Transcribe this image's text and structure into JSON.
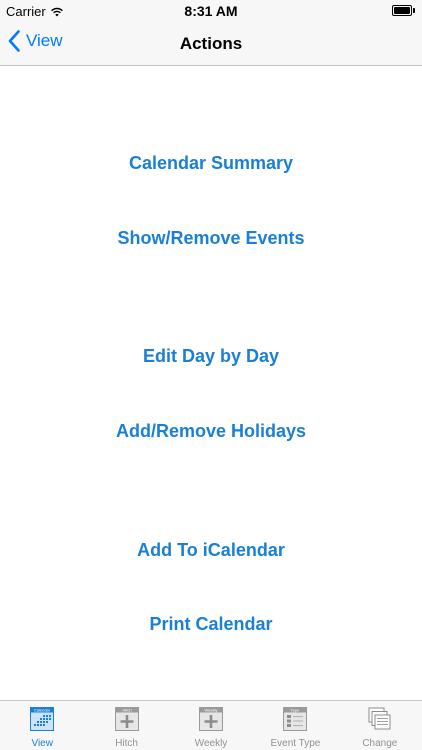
{
  "status": {
    "carrier": "Carrier",
    "time": "8:31 AM"
  },
  "nav": {
    "back_label": "View",
    "title": "Actions"
  },
  "actions": [
    {
      "label": "Calendar Summary"
    },
    {
      "label": "Show/Remove Events"
    },
    {
      "label": "Edit Day by Day"
    },
    {
      "label": "Add/Remove Holidays"
    },
    {
      "label": "Add To iCalendar"
    },
    {
      "label": "Print Calendar"
    }
  ],
  "tabs": [
    {
      "label": "View",
      "icon": "calendar-grid-icon",
      "icon_text": "Calendar",
      "active": true
    },
    {
      "label": "Hitch",
      "icon": "hitch-plus-icon",
      "icon_text": "Hitch",
      "active": false
    },
    {
      "label": "Weekly",
      "icon": "weekly-plus-icon",
      "icon_text": "Weekly",
      "active": false
    },
    {
      "label": "Event Type",
      "icon": "event-type-icon",
      "icon_text": "Type",
      "active": false
    },
    {
      "label": "Change",
      "icon": "stacked-pages-icon",
      "active": false
    }
  ],
  "colors": {
    "accent": "#1a7fd6",
    "ios_blue": "#007aff",
    "bar_bg": "#f7f7f7"
  }
}
